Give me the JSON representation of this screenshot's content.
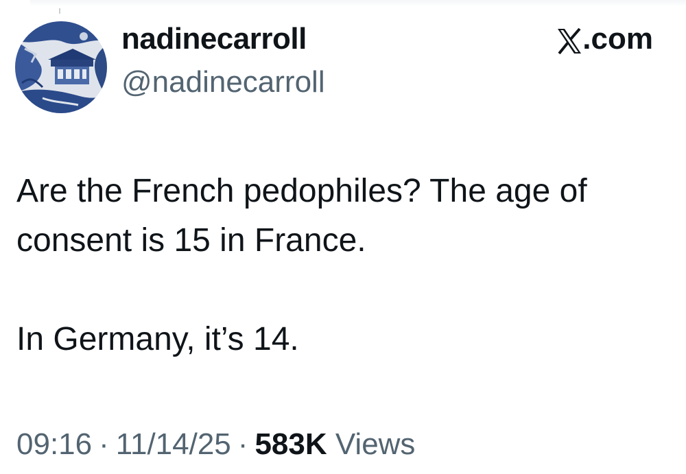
{
  "author": {
    "display_name": "nadinecarroll",
    "handle": "@nadinecarroll"
  },
  "brand": {
    "label": ".com",
    "icon": "x-logo-icon"
  },
  "tweet": {
    "paragraphs": [
      "Are the French pedophiles? The age of consent is 15 in France.",
      "In Germany, it’s 14."
    ]
  },
  "meta": {
    "time": "09:16",
    "separator": "·",
    "date": "11/14/25",
    "views_count": "583K",
    "views_label": "Views"
  },
  "colors": {
    "text_primary": "#0f1419",
    "text_secondary": "#536471",
    "avatar_blue": "#2f4f8f"
  }
}
